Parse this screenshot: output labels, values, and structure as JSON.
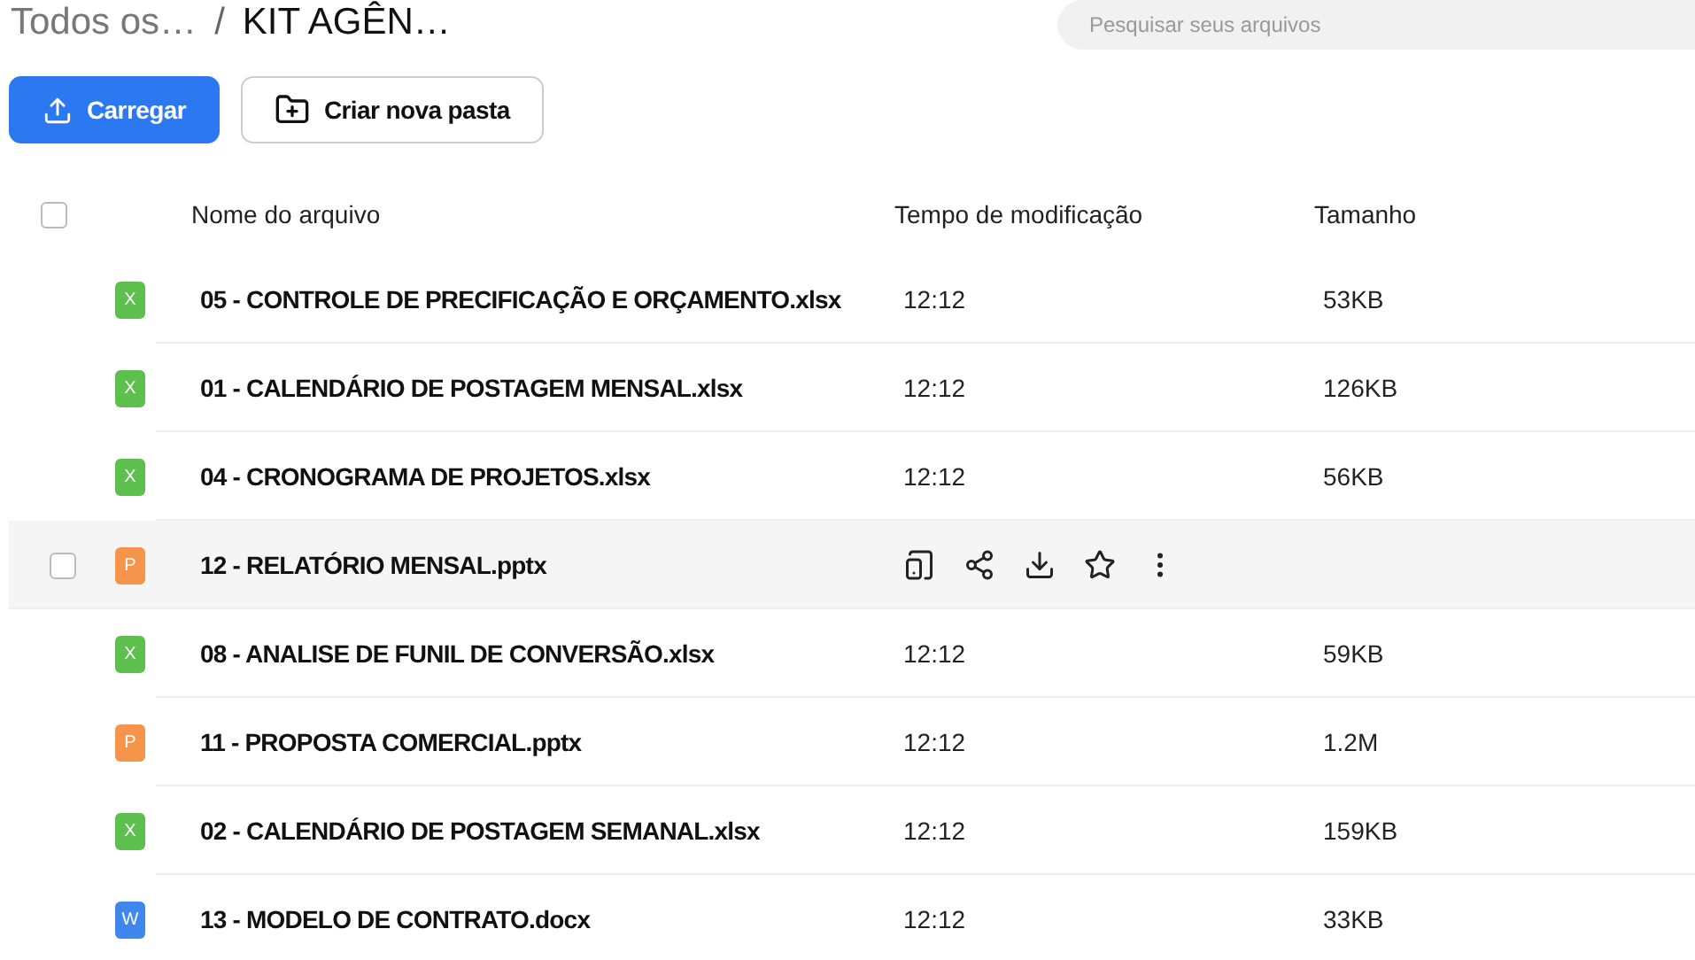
{
  "breadcrumb": {
    "items": [
      {
        "label": "Todos os…",
        "current": false
      },
      {
        "label": "KIT AGÊN…",
        "current": true
      }
    ],
    "separator": "/"
  },
  "search": {
    "placeholder": "Pesquisar seus arquivos"
  },
  "actions": [
    {
      "label": "Carregar",
      "kind": "upload"
    },
    {
      "label": "Criar nova pasta",
      "kind": "folder"
    }
  ],
  "table": {
    "columns": [
      "Nome do arquivo",
      "Tempo de modificação",
      "Tamanho"
    ],
    "select_all_checked": false,
    "rows": [
      {
        "name": "05 - CONTROLE DE PRECIFICAÇÃO E ORÇAMENTO.xlsx",
        "kind": "sheet",
        "icon_letter": "X",
        "modified": "12:12",
        "size": "53KB",
        "hovered": false
      },
      {
        "name": "01 - CALENDÁRIO DE POSTAGEM MENSAL.xlsx",
        "kind": "sheet",
        "icon_letter": "X",
        "modified": "12:12",
        "size": "126KB",
        "hovered": false
      },
      {
        "name": "04 - CRONOGRAMA DE PROJETOS.xlsx",
        "kind": "sheet",
        "icon_letter": "X",
        "modified": "12:12",
        "size": "56KB",
        "hovered": false
      },
      {
        "name": "12 - RELATÓRIO MENSAL.pptx",
        "kind": "slides",
        "icon_letter": "P",
        "hovered": true,
        "checked": false
      },
      {
        "name": "08 - ANALISE DE FUNIL DE CONVERSÃO.xlsx",
        "kind": "sheet",
        "icon_letter": "X",
        "modified": "12:12",
        "size": "59KB",
        "hovered": false
      },
      {
        "name": "11 - PROPOSTA COMERCIAL.pptx",
        "kind": "slides",
        "icon_letter": "P",
        "modified": "12:12",
        "size": "1.2M",
        "hovered": false
      },
      {
        "name": "02 - CALENDÁRIO DE POSTAGEM SEMANAL.xlsx",
        "kind": "sheet",
        "icon_letter": "X",
        "modified": "12:12",
        "size": "159KB",
        "hovered": false
      },
      {
        "name": "13 - MODELO DE CONTRATO.docx",
        "kind": "document",
        "icon_letter": "W",
        "modified": "12:12",
        "size": "33KB",
        "hovered": false
      }
    ]
  }
}
